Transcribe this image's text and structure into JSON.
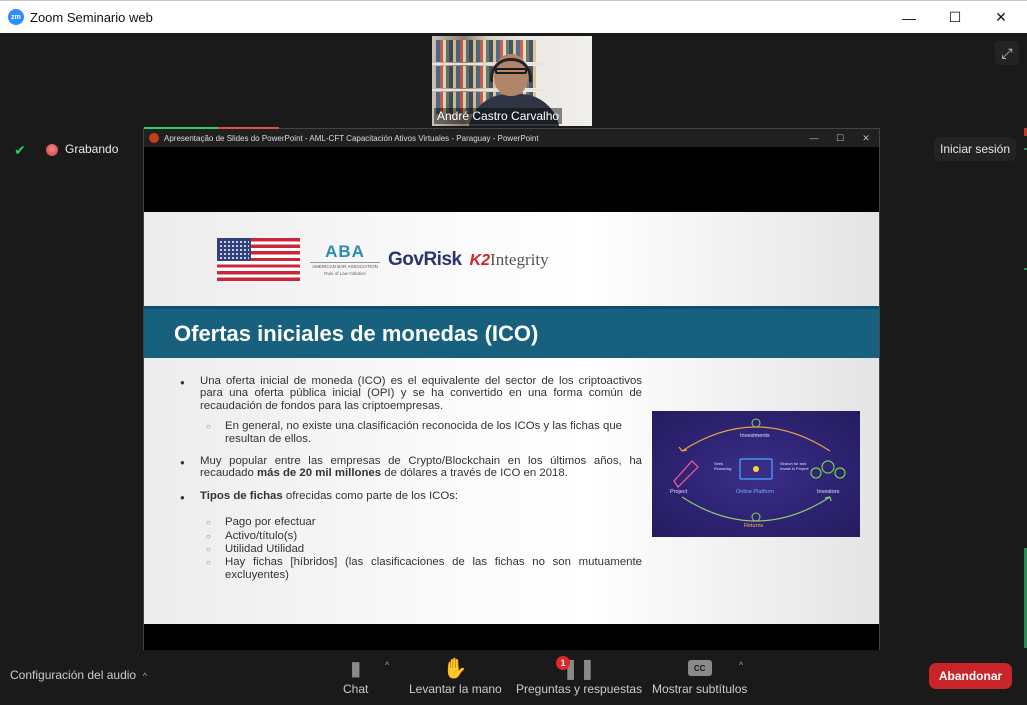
{
  "window": {
    "title": "Zoom Seminario web",
    "app_icon_label": "zm",
    "minimize_glyph": "—",
    "maximize_glyph": "☐",
    "close_glyph": "✕"
  },
  "meeting": {
    "fullscreen_glyph": "⤢",
    "speaker_name": "André Castro Carvalho",
    "recording_label": "Grabando",
    "security_glyph": "✔",
    "signin_label": "Iniciar sesión"
  },
  "share": {
    "window_title": "Apresentação de Slides do PowerPoint  -  AML-CFT Capacitación Ativos Virtuales - Paraguay - PowerPoint",
    "minimize_glyph": "—",
    "maximize_glyph": "☐",
    "close_glyph": "✕"
  },
  "slide": {
    "logos": {
      "aba_mark": "ABA",
      "aba_name": "AMERICAN BAR ASSOCIATION",
      "aba_sub": "Rule of Law Initiative",
      "govrisk": "GovRisk",
      "k2_mark": "K2",
      "k2_word": "Integrity"
    },
    "title": "Ofertas iniciales de monedas (ICO)",
    "bullets": [
      {
        "text": "Una oferta inicial de moneda (ICO) es el equivalente del sector de los criptoactivos para una oferta pública inicial (OPI) y se ha convertido en una forma común de recaudación de fondos para las criptoempresas.",
        "sub": [
          "En general, no existe una clasificación reconocida de los ICOs y las fichas que resultan de ellos."
        ]
      },
      {
        "text_before": "Muy popular entre las empresas de Crypto/Blockchain en los últimos años, ha recaudado ",
        "text_bold": "más de 20 mil millones",
        "text_after": " de dólares a través de ICO en 2018."
      },
      {
        "text_bold": "Tipos de fichas",
        "text_after": " ofrecidas como parte de los ICOs:",
        "sub": [
          "Pago por efectuar",
          "Activo/título(s)",
          "Utilidad Utilidad",
          "Hay fichas [híbridos] (las clasificaciones de las fichas no son mutuamente excluyentes)"
        ]
      }
    ],
    "bullet_glyph": "●",
    "sub_bullet_glyph": "○",
    "graphic": {
      "investments": "Investments",
      "project": "Project",
      "platform": "Online Platform",
      "investors": "Investors",
      "returns": "Returns",
      "left_note": "Seek Financing",
      "right_note": "Search for and Invest in Project"
    }
  },
  "toolbar": {
    "audio_settings": "Configuración del audio",
    "caret_glyph": "^",
    "chat": "Chat",
    "raise_hand": "Levantar la mano",
    "qa": "Preguntas y respuestas",
    "qa_badge": "1",
    "captions": "Mostrar subtítulos",
    "cc_label": "CC",
    "leave": "Abandonar"
  }
}
